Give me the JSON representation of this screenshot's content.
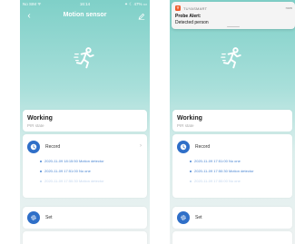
{
  "left": {
    "statusbar": {
      "carrier": "No SIM ᯤ",
      "time": "16:14",
      "right": "✦ ☾ 47% ▭"
    },
    "nav": {
      "back": "‹",
      "title": "Motion sensor"
    },
    "status": {
      "title": "Working",
      "subtitle": "PIR state"
    },
    "record": {
      "label": "Record",
      "chevron": "›",
      "items": [
        "2020-11-09 18:15:50 Motion detector",
        "2020-11-09 17:51:00 No one",
        "2020-11-09 17:50:30 Motion detector"
      ]
    },
    "set": {
      "label": "Set"
    }
  },
  "right": {
    "notification": {
      "app": "TUYASMART",
      "time": "now",
      "title": "Probe Alert:",
      "body": "Detected person"
    },
    "status": {
      "title": "Working",
      "subtitle": "PIR state"
    },
    "record": {
      "label": "Record",
      "items": [
        "2020-11-09 17:51:00 No one",
        "2020-11-09 17:50:30 Motion detector",
        "2020-11-09 17:50:00 No one"
      ]
    },
    "set": {
      "label": "Set"
    }
  },
  "colors": {
    "accent": "#2f6fc8",
    "link": "#4a86d2",
    "header_gradient_top": "#7fd0c8",
    "notification_app": "#ee5a2a"
  },
  "icons": {
    "runner": "running-person-icon",
    "record": "clock-icon",
    "set": "gear-icon",
    "edit": "pencil-icon",
    "back": "back-arrow-icon"
  }
}
